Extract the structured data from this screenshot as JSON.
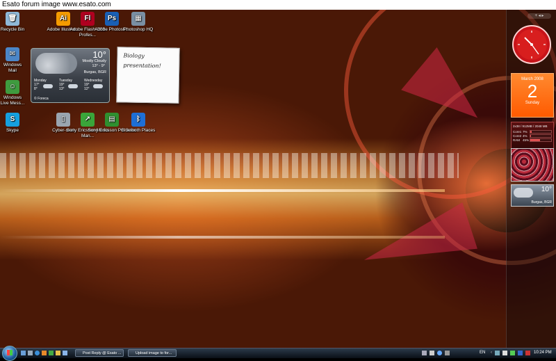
{
  "banner": {
    "text": "Esato forum image www.esato.com"
  },
  "desktop_icons": [
    {
      "label": "Recycle Bin",
      "icon": "recycle-bin-icon",
      "color": "#8fb8d8",
      "glyph": "🗑"
    },
    {
      "label": "Adobe Illustrat...",
      "icon": "illustrator-icon",
      "color": "#f59b00",
      "glyph": "Ai"
    },
    {
      "label": "Adobe Flash CS3 Profes...",
      "icon": "flash-icon",
      "color": "#b00020",
      "glyph": "Fl"
    },
    {
      "label": "Adobe Photosh...",
      "icon": "photoshop-icon",
      "color": "#1a5fb4",
      "glyph": "Ps"
    },
    {
      "label": "Photoshop HQ",
      "icon": "photoshop-hq-icon",
      "color": "#7a8fa3",
      "glyph": "▦"
    },
    {
      "label": "Windows Mail",
      "icon": "mail-icon",
      "color": "#4c86c8",
      "glyph": "✉"
    },
    {
      "label": "Windows Live Mess...",
      "icon": "messenger-icon",
      "color": "#3f9b3f",
      "glyph": "☺"
    },
    {
      "label": "Skype",
      "icon": "skype-icon",
      "color": "#16a0e0",
      "glyph": "S"
    },
    {
      "label": "Cyber-shot",
      "icon": "camera-phone-icon",
      "color": "#9aa5b0",
      "glyph": "▯"
    },
    {
      "label": "Sony Ericsson Media Man...",
      "icon": "media-manager-icon",
      "color": "#3aa53a",
      "glyph": "↗"
    },
    {
      "label": "Sony Ericsson PC Suite",
      "icon": "pc-suite-icon",
      "color": "#2f8f2f",
      "glyph": "▤"
    },
    {
      "label": "Bluetooth Places",
      "icon": "bluetooth-icon",
      "color": "#1e6fd6",
      "glyph": "ᛒ"
    }
  ],
  "weather": {
    "temp": "10°",
    "condition": "Mostly Cloudy",
    "range": "13° - 9°",
    "location": "Burgas, BGR",
    "provider": "© Foreca",
    "days": [
      {
        "name": "Monday",
        "hi": "17°",
        "lo": "8°"
      },
      {
        "name": "Tuesday",
        "hi": "19°",
        "lo": "13°"
      },
      {
        "name": "Wednesday",
        "hi": "19°",
        "lo": "12°"
      }
    ]
  },
  "note": {
    "text": "Biology presentation!"
  },
  "sidebar": {
    "calendar": {
      "month": "March 2008",
      "day": "2",
      "weekday": "Sunday"
    },
    "cpu": {
      "header": "2x38 / 912MB / 2048 MB",
      "rows": [
        {
          "label": "Core1",
          "value": "7%",
          "level": 0.07
        },
        {
          "label": "Core2",
          "value": "4%",
          "level": 0.04
        },
        {
          "label": "RAM",
          "value": "45%",
          "level": 0.45
        }
      ]
    },
    "mini_weather": {
      "temp": "10°",
      "location": "Burgas, BGR"
    }
  },
  "taskbar": {
    "windows": [
      {
        "label": "Post Reply @ Esato ..."
      },
      {
        "label": "Upload image to for..."
      }
    ],
    "lang": "EN",
    "time": "10:24 PM"
  },
  "colors": {
    "clock_red": "#d81e1e",
    "calendar_orange": "#ff6a00"
  }
}
